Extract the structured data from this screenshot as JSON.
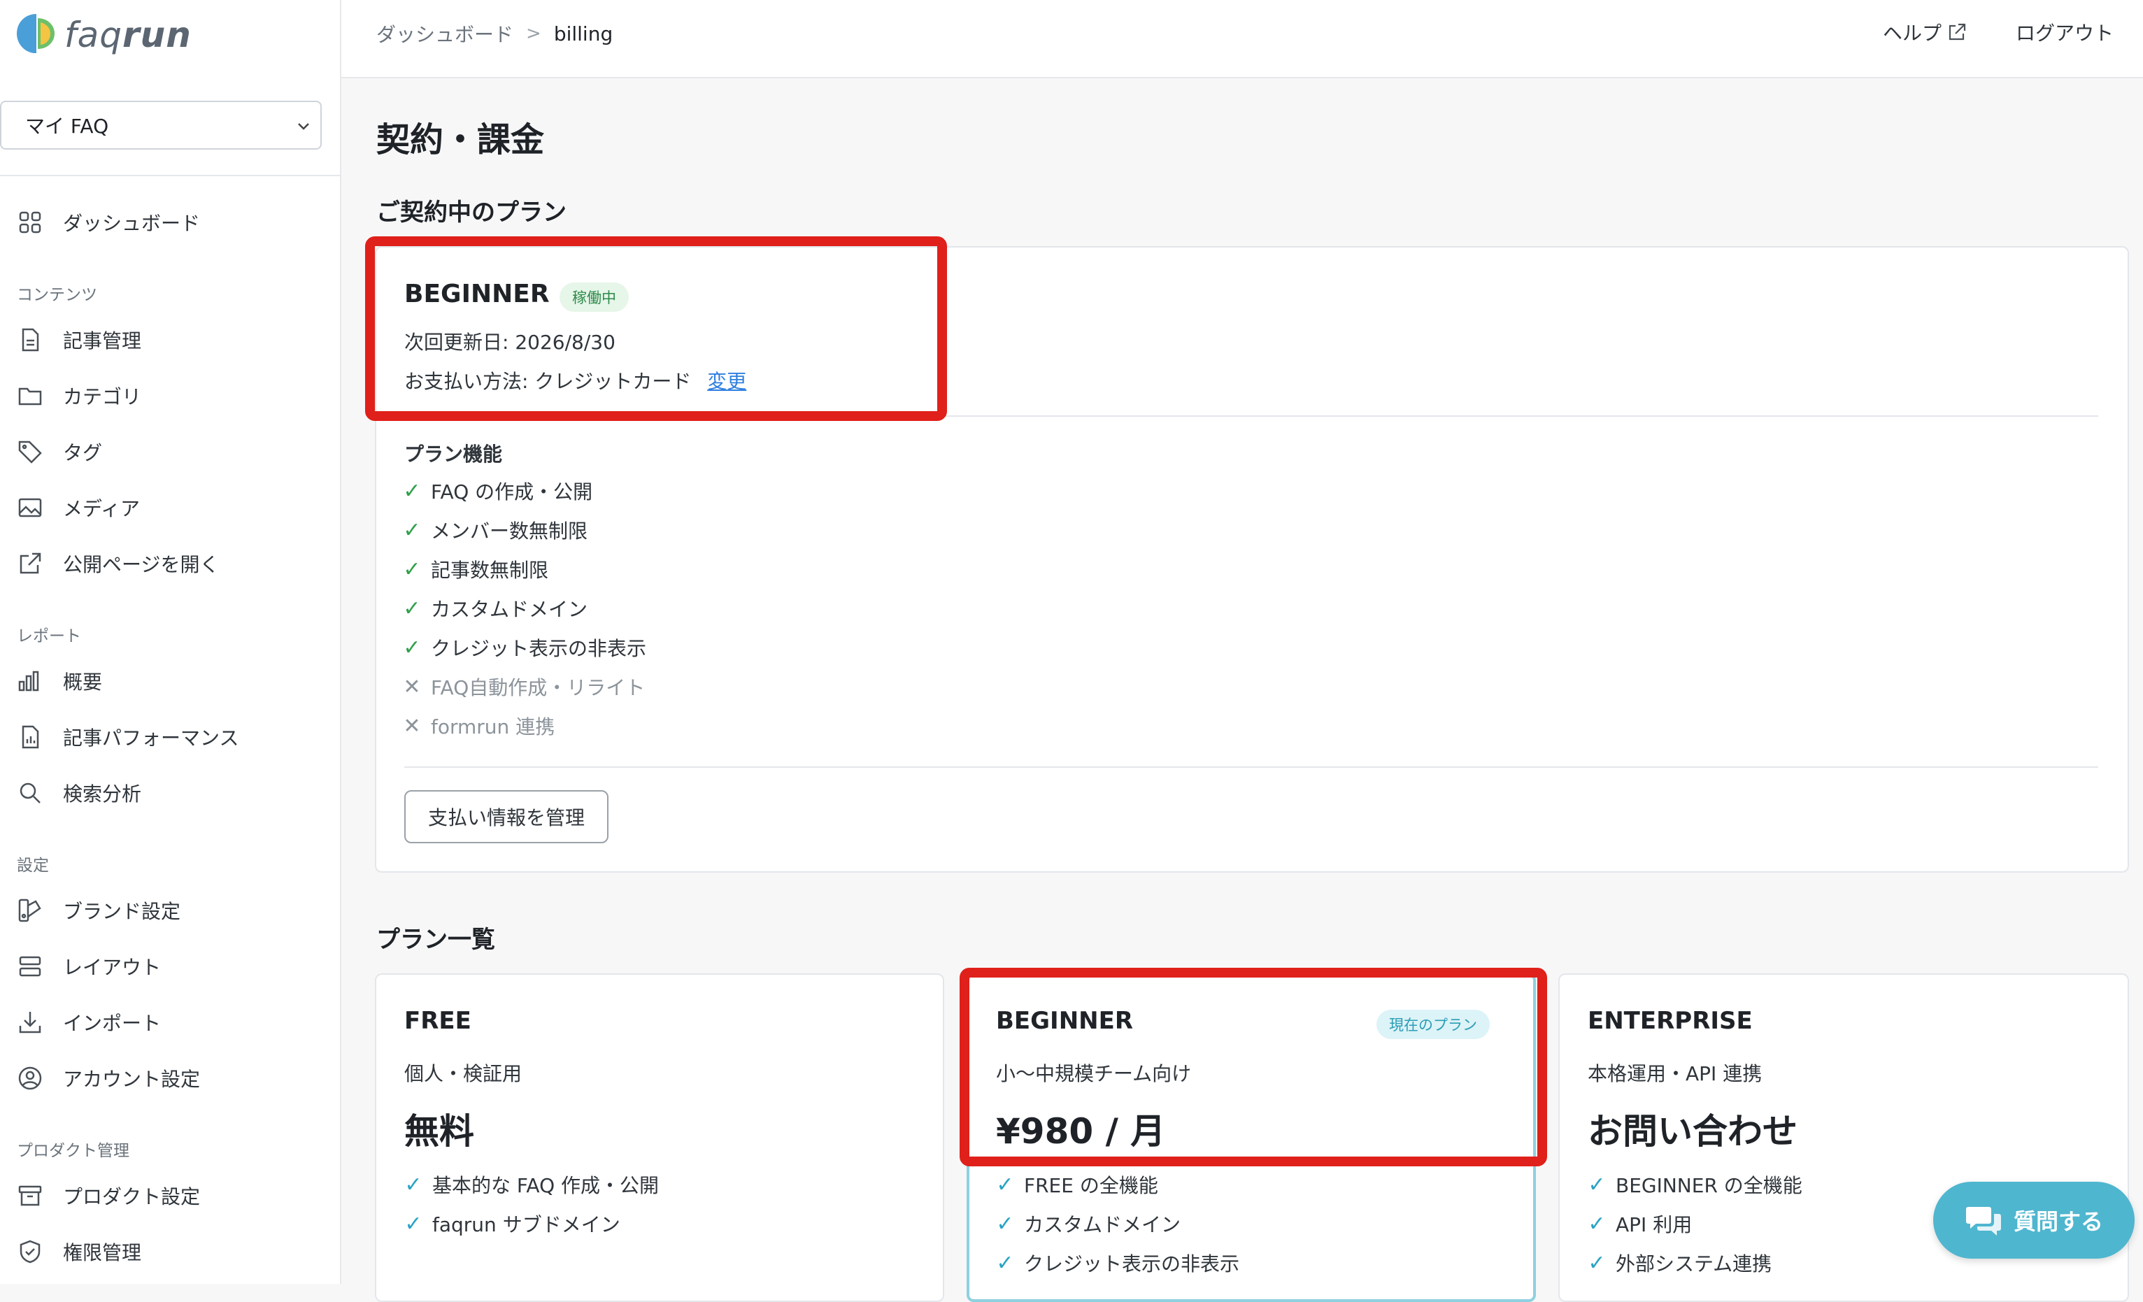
{
  "app": {
    "logo_text_light": "faq",
    "logo_text_bold": "run"
  },
  "sidebar": {
    "faq_select": "マイ FAQ",
    "dashboard": "ダッシュボード",
    "sections": {
      "contents": "コンテンツ",
      "reports": "レポート",
      "settings": "設定",
      "product": "プロダクト管理"
    },
    "items": {
      "articles": "記事管理",
      "categories": "カテゴリ",
      "tags": "タグ",
      "media": "メディア",
      "open_public": "公開ページを開く",
      "overview": "概要",
      "article_perf": "記事パフォーマンス",
      "search_analysis": "検索分析",
      "brand": "ブランド設定",
      "layout": "レイアウト",
      "import": "インポート",
      "account": "アカウント設定",
      "product_settings": "プロダクト設定",
      "permissions": "権限管理"
    }
  },
  "topbar": {
    "breadcrumb_parent": "ダッシュボード",
    "breadcrumb_sep": ">",
    "breadcrumb_current": "billing",
    "help": "ヘルプ",
    "logout": "ログアウト"
  },
  "page": {
    "title": "契約・課金",
    "current_plan_heading": "ご契約中のプラン",
    "plan_list_heading": "プラン一覧"
  },
  "current_plan": {
    "name": "BEGINNER",
    "status_badge": "稼働中",
    "next_renewal": "次回更新日: 2026/8/30",
    "payment_method": "お支払い方法: クレジットカード",
    "change_link": "変更",
    "features_title": "プラン機能",
    "features": [
      {
        "label": "FAQ の作成・公開",
        "included": true
      },
      {
        "label": "メンバー数無制限",
        "included": true
      },
      {
        "label": "記事数無制限",
        "included": true
      },
      {
        "label": "カスタムドメイン",
        "included": true
      },
      {
        "label": "クレジット表示の非表示",
        "included": true
      },
      {
        "label": "FAQ自動作成・リライト",
        "included": false
      },
      {
        "label": "formrun 連携",
        "included": false
      }
    ],
    "manage_button": "支払い情報を管理"
  },
  "plans": [
    {
      "name": "FREE",
      "subtitle": "個人・検証用",
      "price": "無料",
      "features": [
        "基本的な FAQ 作成・公開",
        "faqrun サブドメイン"
      ]
    },
    {
      "name": "BEGINNER",
      "badge": "現在のプラン",
      "subtitle": "小〜中規模チーム向け",
      "price": "¥980 / 月",
      "features": [
        "FREE の全機能",
        "カスタムドメイン",
        "クレジット表示の非表示"
      ]
    },
    {
      "name": "ENTERPRISE",
      "subtitle": "本格運用・API 連携",
      "price": "お問い合わせ",
      "features": [
        "BEGINNER の全機能",
        "API 利用",
        "外部システム連携"
      ]
    }
  ],
  "chat": {
    "label": "質問する"
  },
  "colors": {
    "highlight": "#e0201a",
    "accent": "#4fb6cf",
    "check": "#2fa04a"
  },
  "icons": {
    "check": "✓",
    "cross": "✕"
  }
}
